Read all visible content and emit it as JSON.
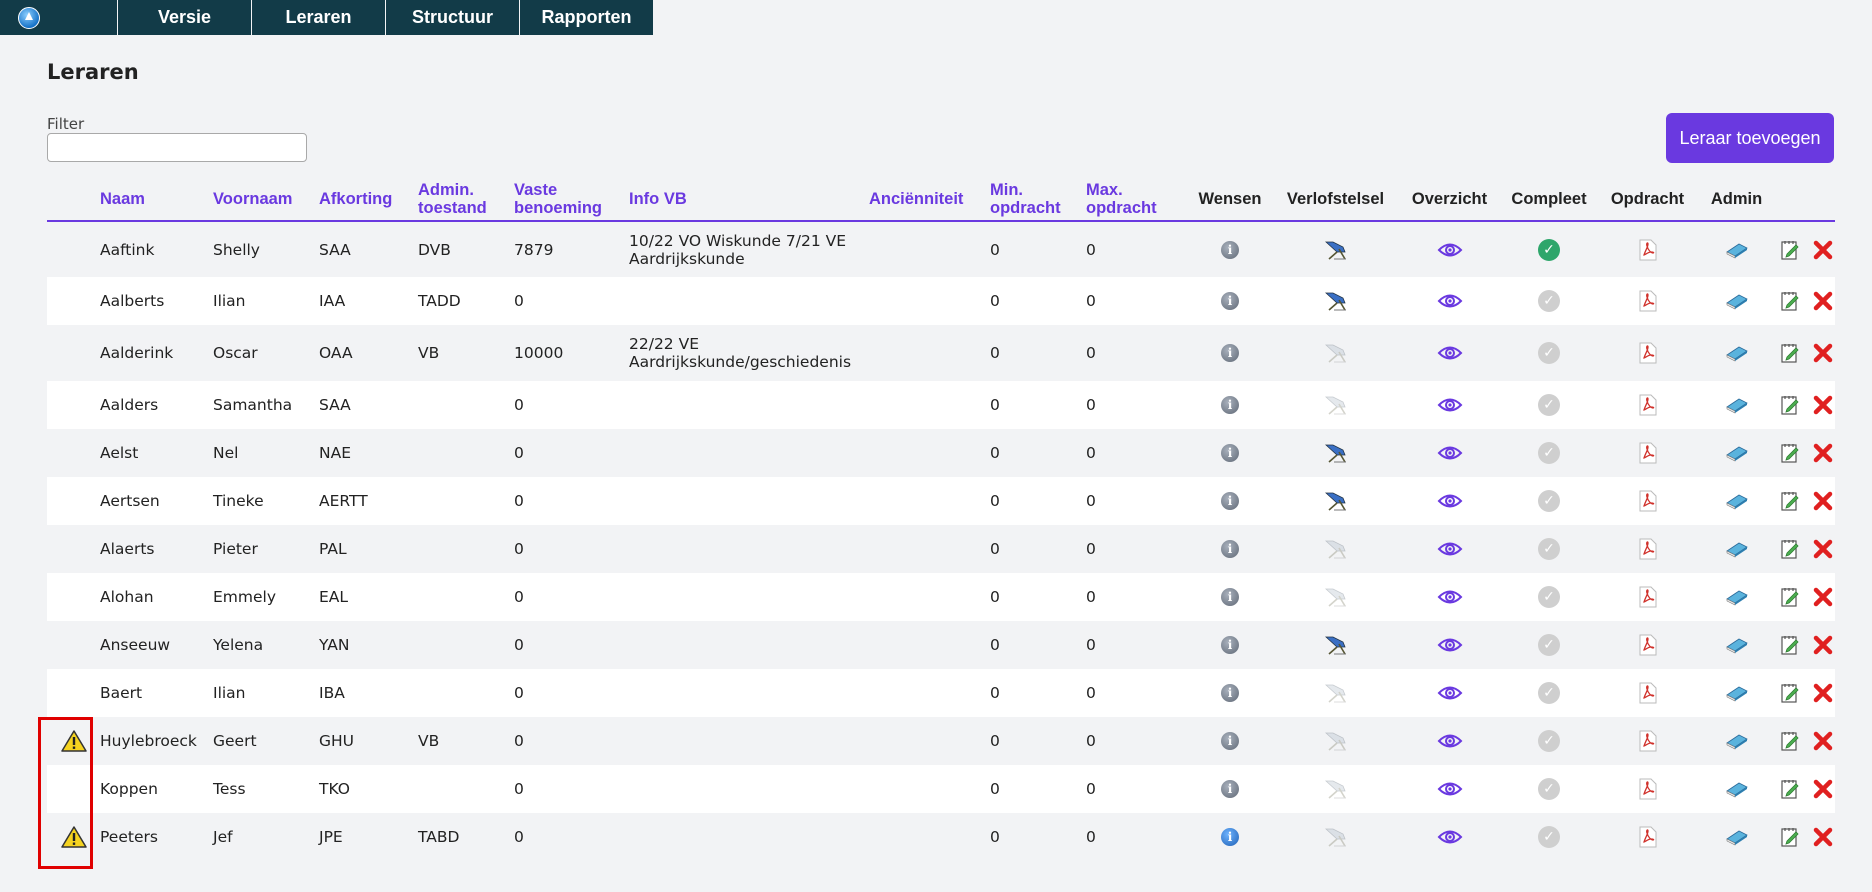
{
  "nav": {
    "home_icon": "home-icon",
    "tabs": [
      "Versie",
      "Leraren",
      "Structuur",
      "Rapporten"
    ]
  },
  "page": {
    "title": "Leraren",
    "filter_label": "Filter",
    "filter_value": "",
    "add_button": "Leraar toevoegen"
  },
  "colors": {
    "accent": "#6a39e0",
    "nav_bg": "#123b48",
    "delete": "#e02020",
    "complete": "#2ea66b"
  },
  "table": {
    "headers": {
      "naam": "Naam",
      "voornaam": "Voornaam",
      "afkorting": "Afkorting",
      "admin1": "Admin.",
      "admin2": "toestand",
      "vaste1": "Vaste",
      "vaste2": "benoeming",
      "infovb": "Info VB",
      "anc": "Anciënniteit",
      "min1": "Min.",
      "min2": "opdracht",
      "max1": "Max.",
      "max2": "opdracht",
      "wensen": "Wensen",
      "verlof": "Verlofstelsel",
      "overzicht": "Overzicht",
      "compleet": "Compleet",
      "opdracht": "Opdracht",
      "admin": "Admin"
    },
    "rows": [
      {
        "warn": false,
        "naam": "Aaftink",
        "voornaam": "Shelly",
        "afk": "SAA",
        "admin": "DVB",
        "vaste": "7879",
        "info1": "10/22 VO Wiskunde 7/21 VE",
        "info2": "Aardrijkskunde",
        "anc": "",
        "min": "0",
        "max": "0",
        "verlof": true,
        "compleet": true,
        "info_active": false
      },
      {
        "warn": false,
        "naam": "Aalberts",
        "voornaam": "Ilian",
        "afk": "IAA",
        "admin": "TADD",
        "vaste": "0",
        "info1": "",
        "info2": "",
        "anc": "",
        "min": "0",
        "max": "0",
        "verlof": true,
        "compleet": false,
        "info_active": false
      },
      {
        "warn": false,
        "naam": "Aalderink",
        "voornaam": "Oscar",
        "afk": "OAA",
        "admin": "VB",
        "vaste": "10000",
        "info1": "22/22 VE",
        "info2": "Aardrijkskunde/geschiedenis",
        "anc": "",
        "min": "0",
        "max": "0",
        "verlof": false,
        "compleet": false,
        "info_active": false
      },
      {
        "warn": false,
        "naam": "Aalders",
        "voornaam": "Samantha",
        "afk": "SAA",
        "admin": "",
        "vaste": "0",
        "info1": "",
        "info2": "",
        "anc": "",
        "min": "0",
        "max": "0",
        "verlof": false,
        "compleet": false,
        "info_active": false
      },
      {
        "warn": false,
        "naam": "Aelst",
        "voornaam": "Nel",
        "afk": "NAE",
        "admin": "",
        "vaste": "0",
        "info1": "",
        "info2": "",
        "anc": "",
        "min": "0",
        "max": "0",
        "verlof": true,
        "compleet": false,
        "info_active": false
      },
      {
        "warn": false,
        "naam": "Aertsen",
        "voornaam": "Tineke",
        "afk": "AERTT",
        "admin": "",
        "vaste": "0",
        "info1": "",
        "info2": "",
        "anc": "",
        "min": "0",
        "max": "0",
        "verlof": true,
        "compleet": false,
        "info_active": false
      },
      {
        "warn": false,
        "naam": "Alaerts",
        "voornaam": "Pieter",
        "afk": "PAL",
        "admin": "",
        "vaste": "0",
        "info1": "",
        "info2": "",
        "anc": "",
        "min": "0",
        "max": "0",
        "verlof": false,
        "compleet": false,
        "info_active": false
      },
      {
        "warn": false,
        "naam": "Alohan",
        "voornaam": "Emmely",
        "afk": "EAL",
        "admin": "",
        "vaste": "0",
        "info1": "",
        "info2": "",
        "anc": "",
        "min": "0",
        "max": "0",
        "verlof": false,
        "compleet": false,
        "info_active": false
      },
      {
        "warn": false,
        "naam": "Anseeuw",
        "voornaam": "Yelena",
        "afk": "YAN",
        "admin": "",
        "vaste": "0",
        "info1": "",
        "info2": "",
        "anc": "",
        "min": "0",
        "max": "0",
        "verlof": true,
        "compleet": false,
        "info_active": false
      },
      {
        "warn": false,
        "naam": "Baert",
        "voornaam": "Ilian",
        "afk": "IBA",
        "admin": "",
        "vaste": "0",
        "info1": "",
        "info2": "",
        "anc": "",
        "min": "0",
        "max": "0",
        "verlof": false,
        "compleet": false,
        "info_active": false
      },
      {
        "warn": true,
        "naam": "Huylebroeck",
        "voornaam": "Geert",
        "afk": "GHU",
        "admin": "VB",
        "vaste": "0",
        "info1": "",
        "info2": "",
        "anc": "",
        "min": "0",
        "max": "0",
        "verlof": false,
        "compleet": false,
        "info_active": false
      },
      {
        "warn": false,
        "naam": "Koppen",
        "voornaam": "Tess",
        "afk": "TKO",
        "admin": "",
        "vaste": "0",
        "info1": "",
        "info2": "",
        "anc": "",
        "min": "0",
        "max": "0",
        "verlof": false,
        "compleet": false,
        "info_active": false
      },
      {
        "warn": true,
        "naam": "Peeters",
        "voornaam": "Jef",
        "afk": "JPE",
        "admin": "TABD",
        "vaste": "0",
        "info1": "",
        "info2": "",
        "anc": "",
        "min": "0",
        "max": "0",
        "verlof": false,
        "compleet": false,
        "info_active": true
      }
    ]
  }
}
